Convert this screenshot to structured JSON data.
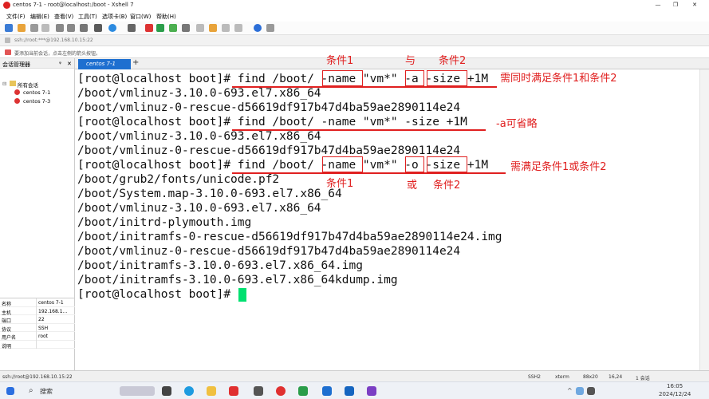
{
  "window": {
    "title": "centos 7-1 - root@localhost:/boot - Xshell 7",
    "min": "—",
    "max": "❐",
    "close": "✕"
  },
  "menu": [
    "文件(F)",
    "编辑(E)",
    "查看(V)",
    "工具(T)",
    "选项卡(B)",
    "窗口(W)",
    "帮助(H)"
  ],
  "address": "ssh://root:***@192.168.10.15:22",
  "hint": "要添加当前会话，点击左侧的箭头按钮。",
  "session_manager": {
    "title": "会话管理器",
    "pin": "ᵠ",
    "close": "✕",
    "root": "所有会话",
    "items": [
      "centos 7-1",
      "centos 7-3"
    ]
  },
  "properties": [
    {
      "k": "名称",
      "v": "centos 7-1"
    },
    {
      "k": "主机",
      "v": "192.168.1..."
    },
    {
      "k": "端口",
      "v": "22"
    },
    {
      "k": "协议",
      "v": "SSH"
    },
    {
      "k": "用户名",
      "v": "root"
    },
    {
      "k": "说明",
      "v": ""
    }
  ],
  "tab": {
    "label": "centos 7-1",
    "plus": "+"
  },
  "terminal_lines": [
    "[root@localhost boot]# find /boot/ -name \"vm*\" -a -size +1M",
    "/boot/vmlinuz-3.10.0-693.el7.x86_64",
    "/boot/vmlinuz-0-rescue-d56619df917b47d4ba59ae2890114e24",
    "[root@localhost boot]# find /boot/ -name \"vm*\" -size +1M",
    "/boot/vmlinuz-3.10.0-693.el7.x86_64",
    "/boot/vmlinuz-0-rescue-d56619df917b47d4ba59ae2890114e24",
    "[root@localhost boot]# find /boot/ -name \"vm*\" -o -size +1M",
    "/boot/grub2/fonts/unicode.pf2",
    "/boot/System.map-3.10.0-693.el7.x86_64",
    "/boot/vmlinuz-3.10.0-693.el7.x86_64",
    "/boot/initrd-plymouth.img",
    "/boot/initramfs-0-rescue-d56619df917b47d4ba59ae2890114e24.img",
    "/boot/vmlinuz-0-rescue-d56619df917b47d4ba59ae2890114e24",
    "/boot/initramfs-3.10.0-693.el7.x86_64.img",
    "/boot/initramfs-3.10.0-693.el7.x86_64kdump.img",
    "[root@localhost boot]# "
  ],
  "annotations": {
    "cond1_top": "条件1",
    "and_word": "与",
    "cond2_top": "条件2",
    "note_and": "需同时满足条件1和条件2",
    "note_optional": "-a可省略",
    "note_or": "需满足条件1或条件2",
    "cond1_bottom": "条件1",
    "or_word": "或",
    "cond2_bottom": "条件2"
  },
  "status": {
    "left": "ssh://root@192.168.10.15:22",
    "proto": "SSH2",
    "term": "xterm",
    "size": "88x20",
    "pos": "16,24",
    "sessions": "1 会话",
    "time": "16:05",
    "date": "2024/12/24"
  },
  "taskbar": {
    "search": "搜索"
  },
  "colors": {
    "accent": "#1e6fd0",
    "annotation": "#e02020",
    "cursor": "#00e070"
  }
}
